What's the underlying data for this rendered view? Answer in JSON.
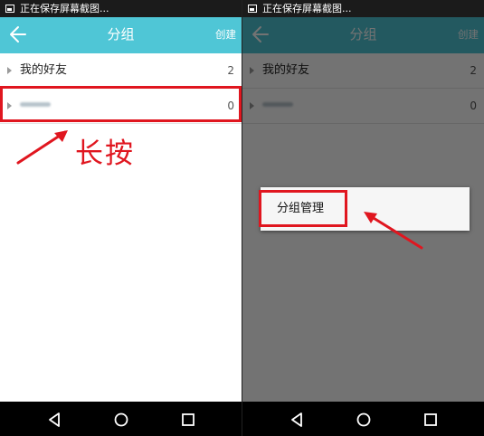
{
  "status_bar": {
    "text": "正在保存屏幕截图..."
  },
  "header": {
    "title": "分组",
    "create_label": "创建"
  },
  "groups": [
    {
      "name": "我的好友",
      "count": "2"
    },
    {
      "name": "",
      "count": "0"
    }
  ],
  "annotation": {
    "text": "长按"
  },
  "context_menu": {
    "items": [
      {
        "label": "分组管理"
      }
    ]
  },
  "colors": {
    "title_bar": "#4fc6d6",
    "highlight": "#e0161f",
    "nav_bar": "#000000",
    "status_bar": "#1b1b1b"
  },
  "icons": {
    "back": "arrow-left-icon",
    "nav_back": "triangle-back-icon",
    "nav_home": "circle-home-icon",
    "nav_recent": "square-recent-icon",
    "status": "image-icon"
  }
}
